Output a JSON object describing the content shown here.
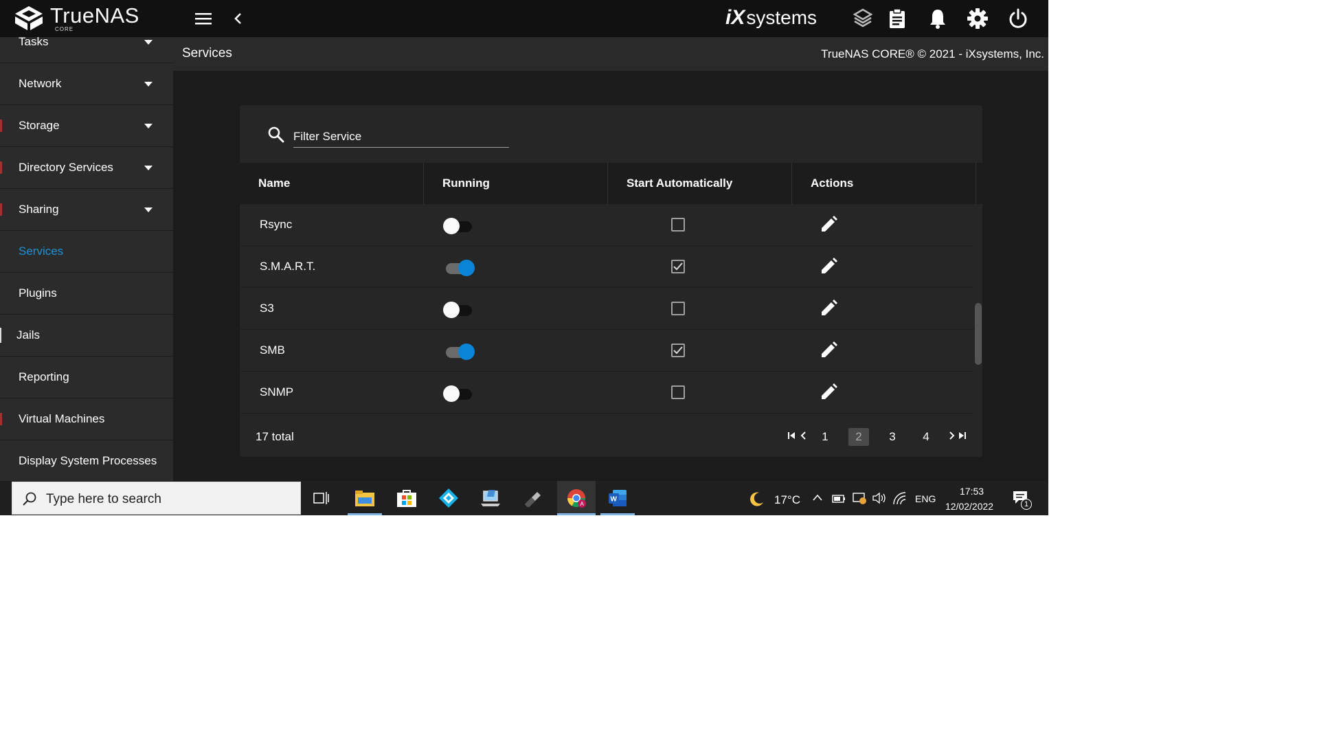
{
  "app": {
    "brand": "TrueNAS",
    "brand_sub": "CORE",
    "vendor_prefix": "iX",
    "vendor_suffix": "systems"
  },
  "sidebar": {
    "items": [
      {
        "label": "Tasks",
        "expandable": true,
        "active": false
      },
      {
        "label": "Network",
        "expandable": true,
        "active": false
      },
      {
        "label": "Storage",
        "expandable": true,
        "active": false
      },
      {
        "label": "Directory Services",
        "expandable": true,
        "active": false
      },
      {
        "label": "Sharing",
        "expandable": true,
        "active": false
      },
      {
        "label": "Services",
        "expandable": false,
        "active": true
      },
      {
        "label": "Plugins",
        "expandable": false,
        "active": false
      },
      {
        "label": "Jails",
        "expandable": false,
        "active": false
      },
      {
        "label": "Reporting",
        "expandable": false,
        "active": false
      },
      {
        "label": "Virtual Machines",
        "expandable": false,
        "active": false
      },
      {
        "label": "Display System Processes",
        "expandable": false,
        "active": false
      }
    ]
  },
  "header": {
    "title": "Services",
    "copyright": "TrueNAS CORE® © 2021 - iXsystems, Inc."
  },
  "services": {
    "filter_placeholder": "Filter Service",
    "columns": [
      "Name",
      "Running",
      "Start Automatically",
      "Actions"
    ],
    "rows": [
      {
        "name": "Rsync",
        "running": false,
        "start_auto": false
      },
      {
        "name": "S.M.A.R.T.",
        "running": true,
        "start_auto": true
      },
      {
        "name": "S3",
        "running": false,
        "start_auto": false
      },
      {
        "name": "SMB",
        "running": true,
        "start_auto": true
      },
      {
        "name": "SNMP",
        "running": false,
        "start_auto": false
      }
    ],
    "total_label": "17 total",
    "pages": [
      "1",
      "2",
      "3",
      "4"
    ],
    "current_page": "2"
  },
  "taskbar": {
    "search_placeholder": "Type here to search",
    "weather": "17°C",
    "language": "ENG",
    "time": "17:53",
    "date": "12/02/2022",
    "notification_count": "1"
  },
  "colors": {
    "accent": "#0a84d6",
    "active_nav": "#1e90d6",
    "topbar": "#111111",
    "sidebar": "#2b2b2b",
    "card": "#262626"
  }
}
